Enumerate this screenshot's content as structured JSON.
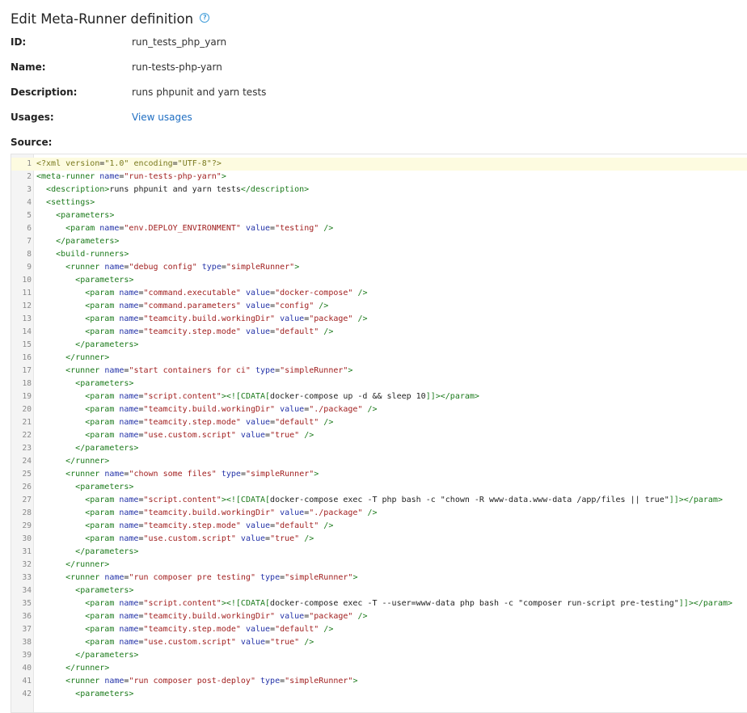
{
  "header": {
    "title": "Edit Meta-Runner definition",
    "help_icon": "question-circle-icon"
  },
  "fields": {
    "id_label": "ID:",
    "id_value": "run_tests_php_yarn",
    "name_label": "Name:",
    "name_value": "run-tests-php-yarn",
    "description_label": "Description:",
    "description_value": "runs phpunit and yarn tests",
    "usages_label": "Usages:",
    "usages_link": "View usages",
    "source_label": "Source:"
  },
  "colors": {
    "tag": "#1b7a1b",
    "attribute": "#2433a8",
    "string": "#a11f1f",
    "link": "#1f6ec2",
    "active_line": "#fdfbe0"
  },
  "source_lines": [
    "<?xml version=\"1.0\" encoding=\"UTF-8\"?>",
    "<meta-runner name=\"run-tests-php-yarn\">",
    "  <description>runs phpunit and yarn tests</description>",
    "  <settings>",
    "    <parameters>",
    "      <param name=\"env.DEPLOY_ENVIRONMENT\" value=\"testing\" />",
    "    </parameters>",
    "    <build-runners>",
    "      <runner name=\"debug config\" type=\"simpleRunner\">",
    "        <parameters>",
    "          <param name=\"command.executable\" value=\"docker-compose\" />",
    "          <param name=\"command.parameters\" value=\"config\" />",
    "          <param name=\"teamcity.build.workingDir\" value=\"package\" />",
    "          <param name=\"teamcity.step.mode\" value=\"default\" />",
    "        </parameters>",
    "      </runner>",
    "      <runner name=\"start containers for ci\" type=\"simpleRunner\">",
    "        <parameters>",
    "          <param name=\"script.content\"><![CDATA[docker-compose up -d && sleep 10]]></param>",
    "          <param name=\"teamcity.build.workingDir\" value=\"./package\" />",
    "          <param name=\"teamcity.step.mode\" value=\"default\" />",
    "          <param name=\"use.custom.script\" value=\"true\" />",
    "        </parameters>",
    "      </runner>",
    "      <runner name=\"chown some files\" type=\"simpleRunner\">",
    "        <parameters>",
    "          <param name=\"script.content\"><![CDATA[docker-compose exec -T php bash -c \"chown -R www-data.www-data /app/files || true\"]]></param>",
    "          <param name=\"teamcity.build.workingDir\" value=\"./package\" />",
    "          <param name=\"teamcity.step.mode\" value=\"default\" />",
    "          <param name=\"use.custom.script\" value=\"true\" />",
    "        </parameters>",
    "      </runner>",
    "      <runner name=\"run composer pre testing\" type=\"simpleRunner\">",
    "        <parameters>",
    "          <param name=\"script.content\"><![CDATA[docker-compose exec -T --user=www-data php bash -c \"composer run-script pre-testing\"]]></param>",
    "          <param name=\"teamcity.build.workingDir\" value=\"package\" />",
    "          <param name=\"teamcity.step.mode\" value=\"default\" />",
    "          <param name=\"use.custom.script\" value=\"true\" />",
    "        </parameters>",
    "      </runner>",
    "      <runner name=\"run composer post-deploy\" type=\"simpleRunner\">",
    "        <parameters>"
  ]
}
